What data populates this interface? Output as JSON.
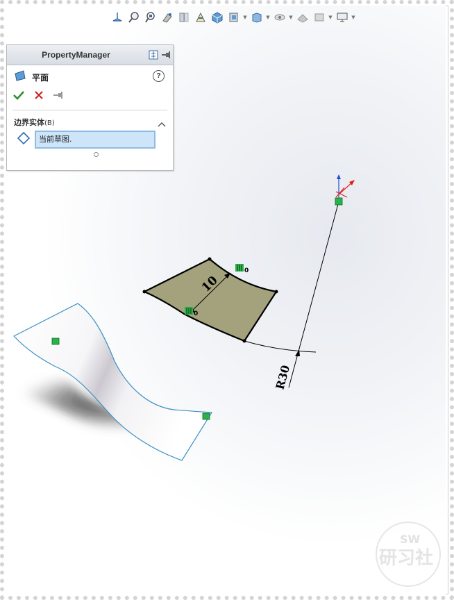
{
  "property_manager": {
    "title": "PropertyManager",
    "feature_name": "平面",
    "help": "?",
    "section_title": "边界实体",
    "section_key": "(B)",
    "selection_value": "当前草图."
  },
  "sketch": {
    "dim_width": "10",
    "dim_radius": "R30",
    "relation_count_1": "0",
    "relation_count_2": "0"
  },
  "watermark": {
    "line1": "SW",
    "line2": "研习社"
  },
  "colors": {
    "sketch_fill": "#a3a27c",
    "surface_edge": "#3a8fc4",
    "relation_green": "#2bb24c",
    "accept": "#2e8b2e",
    "cancel": "#cc2222",
    "selection_bg": "#cde4f9"
  }
}
